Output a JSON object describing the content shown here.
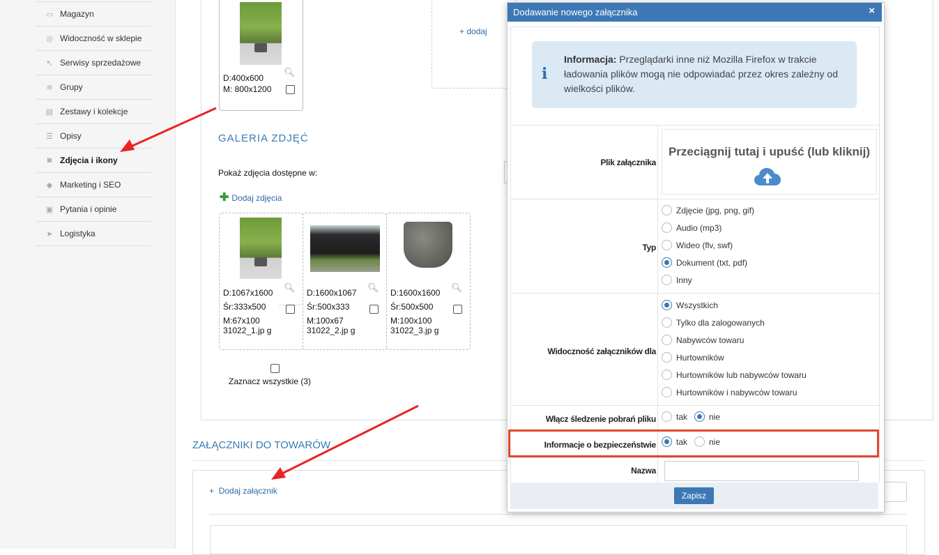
{
  "sidebar": {
    "items": [
      {
        "label": "Magazyn",
        "icon": "box-icon"
      },
      {
        "label": "Widoczność w sklepie",
        "icon": "eye-icon"
      },
      {
        "label": "Serwisy sprzedażowe",
        "icon": "hammer-icon"
      },
      {
        "label": "Grupy",
        "icon": "layers-icon"
      },
      {
        "label": "Zestawy i kolekcje",
        "icon": "collection-icon"
      },
      {
        "label": "Opisy",
        "icon": "text-icon"
      },
      {
        "label": "Zdjęcia i ikony",
        "icon": "camera-icon",
        "active": true
      },
      {
        "label": "Marketing i SEO",
        "icon": "tag-icon"
      },
      {
        "label": "Pytania i opinie",
        "icon": "chat-icon"
      },
      {
        "label": "Logistyka",
        "icon": "plane-icon"
      }
    ]
  },
  "main_image": {
    "dims_d": "D:400x600",
    "dims_m": "M: 800x1200"
  },
  "add_link": "+ dodaj",
  "gallery": {
    "title": "GALERIA ZDJĘĆ",
    "subtitle": "Pokaż zdjęcia dostępne w:",
    "add_photos": "Dodaj zdjęcia",
    "photos": [
      {
        "d": "D:1067x1600",
        "sr": "Śr:333x500",
        "m": "M:67x100",
        "file": "31022_1.jp g"
      },
      {
        "d": "D:1600x1067",
        "sr": "Śr:500x333",
        "m": "M:100x67",
        "file": "31022_2.jp g"
      },
      {
        "d": "D:1600x1600",
        "sr": "Śr:500x500",
        "m": "M:100x100",
        "file": "31022_3.jp g"
      }
    ],
    "select_all": "Zaznacz wszystkie (3)"
  },
  "attachments": {
    "title": "ZAŁĄCZNIKI DO TOWARÓW",
    "add_label": "Dodaj załącznik"
  },
  "modal": {
    "title": "Dodawanie nowego załącznika",
    "close": "×",
    "info_bold": "Informacja:",
    "info_text": " Przeglądarki inne niż Mozilla Firefox w trakcie ładowania plików mogą nie odpowiadać przez okres zależny od wielkości plików.",
    "file_label": "Plik załącznika",
    "drop_text": "Przeciągnij tutaj i upuść (lub kliknij)",
    "type_label": "Typ",
    "type_options": [
      "Zdjęcie (jpg, png, gif)",
      "Audio (mp3)",
      "Wideo (flv, swf)",
      "Dokument (txt, pdf)",
      "Inny"
    ],
    "type_selected": 3,
    "visibility_label": "Widoczność załączników dla",
    "visibility_options": [
      "Wszystkich",
      "Tylko dla zalogowanych",
      "Nabywców towaru",
      "Hurtowników",
      "Hurtowników lub nabywców towaru",
      "Hurtowników i nabywców towaru"
    ],
    "visibility_selected": 0,
    "tracking_label": "Włącz śledzenie pobrań pliku",
    "tracking_yes": "tak",
    "tracking_no": "nie",
    "tracking_selected": "no",
    "security_label": "Informacje o bezpieczeństwie",
    "security_yes": "tak",
    "security_no": "nie",
    "security_selected": "yes",
    "name_label": "Nazwa",
    "name_value": "",
    "save": "Zapisz"
  },
  "colors": {
    "accent": "#3c78b5",
    "highlight": "#e0482e",
    "arrow": "#e82424"
  }
}
